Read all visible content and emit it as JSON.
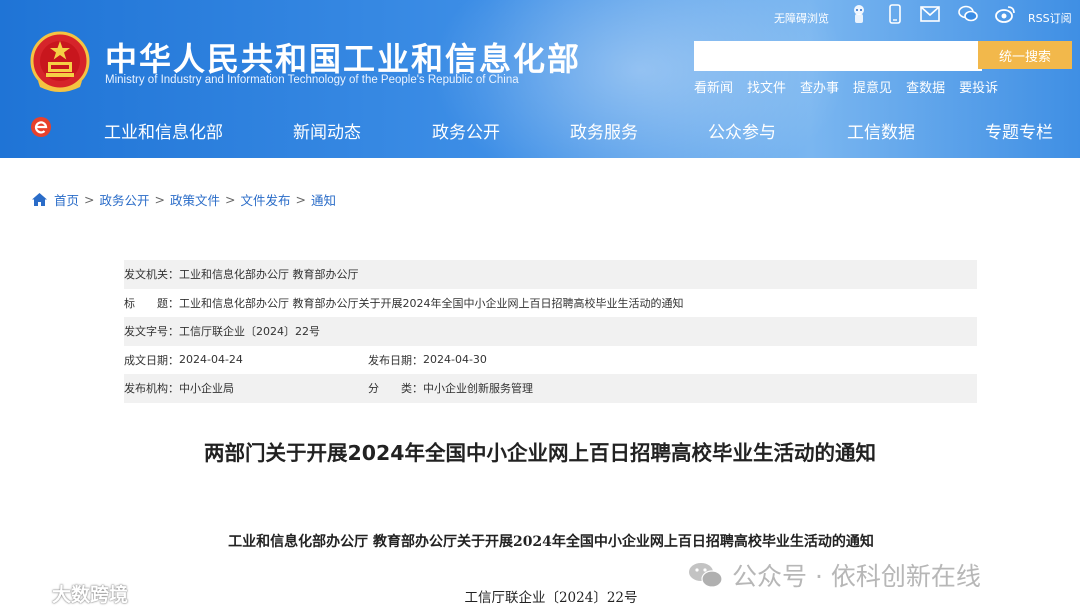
{
  "header": {
    "title": "中华人民共和国工业和信息化部",
    "subtitle": "Ministry of Industry and Information Technology of the People's Republic of China",
    "accessibility_label": "无障碍浏览",
    "rss_label": "RSS订阅",
    "search": {
      "placeholder": "",
      "button_label": "统一搜索"
    },
    "quick_links": [
      "看新闻",
      "找文件",
      "查办事",
      "提意见",
      "查数据",
      "要投诉"
    ],
    "icons": [
      "robot-icon",
      "mobile-icon",
      "mail-icon",
      "wechat-icon",
      "weibo-icon"
    ]
  },
  "nav": {
    "items": [
      "工业和信息化部",
      "新闻动态",
      "政务公开",
      "政务服务",
      "公众参与",
      "工信数据",
      "专题专栏"
    ]
  },
  "breadcrumb": [
    "首页",
    "政务公开",
    "政策文件",
    "文件发布",
    "通知"
  ],
  "meta": {
    "issuer_label": "发文机关：",
    "issuer": "工业和信息化部办公厅 教育部办公厅",
    "title_label": "标　　题：",
    "title": "工业和信息化部办公厅 教育部办公厅关于开展2024年全国中小企业网上百日招聘高校毕业生活动的通知",
    "doc_no_label": "发文字号：",
    "doc_no": "工信厅联企业〔2024〕22号",
    "created_label": "成文日期：",
    "created": "2024-04-24",
    "published_label": "发布日期：",
    "published": "2024-04-30",
    "agency_label": "发布机构：",
    "agency": "中小企业局",
    "category_label": "分　　类：",
    "category": "中小企业创新服务管理"
  },
  "document": {
    "title": "两部门关于开展2024年全国中小企业网上百日招聘高校毕业生活动的通知",
    "subtitle": "工业和信息化部办公厅  教育部办公厅关于开展2024年全国中小企业网上百日招聘高校毕业生活动的通知",
    "number": "工信厅联企业〔2024〕22号"
  },
  "watermarks": {
    "left": "大数跨境",
    "right": "公众号 · 依科创新在线"
  },
  "colors": {
    "header_blue": "#1f74d6",
    "search_button": "#f2b84b",
    "link_blue": "#2a6cc8",
    "meta_shade": "#f1f1f1"
  }
}
